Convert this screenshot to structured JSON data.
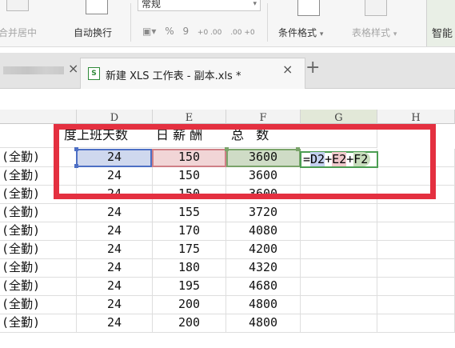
{
  "ribbon": {
    "merge_center_label": "合并居中",
    "auto_wrap_label": "自动换行",
    "number_format_value": "常规",
    "percent_symbol": "%",
    "comma_symbol": "9",
    "decimal_increase": "+0 .00",
    "decimal_decrease": ".00 +0",
    "cond_format_label": "条件格式",
    "table_style_label": "表格样式",
    "smart_label": "智能"
  },
  "tabs": {
    "active_title": "新建 XLS 工作表 - 副本.xls *",
    "xls_icon_text": "S",
    "close_glyph": "×",
    "new_tab_glyph": "+"
  },
  "grid": {
    "columns": [
      "D",
      "E",
      "F",
      "G",
      "H"
    ],
    "header_row": {
      "c_fragment": "度",
      "d": "上班天数",
      "e": "日 薪 酬",
      "f": "总   数"
    },
    "rows": [
      {
        "c": "(全勤)",
        "d": "24",
        "e": "150",
        "f": "3600"
      },
      {
        "c": "(全勤)",
        "d": "24",
        "e": "150",
        "f": "3600"
      },
      {
        "c": "(全勤)",
        "d": "24",
        "e": "150",
        "f": "3600"
      },
      {
        "c": "(全勤)",
        "d": "24",
        "e": "155",
        "f": "3720"
      },
      {
        "c": "(全勤)",
        "d": "24",
        "e": "170",
        "f": "4080"
      },
      {
        "c": "(全勤)",
        "d": "24",
        "e": "175",
        "f": "4200"
      },
      {
        "c": "(全勤)",
        "d": "24",
        "e": "180",
        "f": "4320"
      },
      {
        "c": "(全勤)",
        "d": "24",
        "e": "195",
        "f": "4680"
      },
      {
        "c": "(全勤)",
        "d": "24",
        "e": "200",
        "f": "4800"
      },
      {
        "c": "(全勤)",
        "d": "24",
        "e": "200",
        "f": "4800"
      }
    ],
    "formula": {
      "eq": "=",
      "ref_d": "D2",
      "plus1": "+",
      "ref_e": "E2",
      "plus2": "+",
      "ref_f": "F2"
    }
  },
  "colors": {
    "annotation_red": "#e43040",
    "ref_blue": "#4d6fc4",
    "ref_pink": "#cf7f86",
    "ref_green": "#7aa36a"
  }
}
